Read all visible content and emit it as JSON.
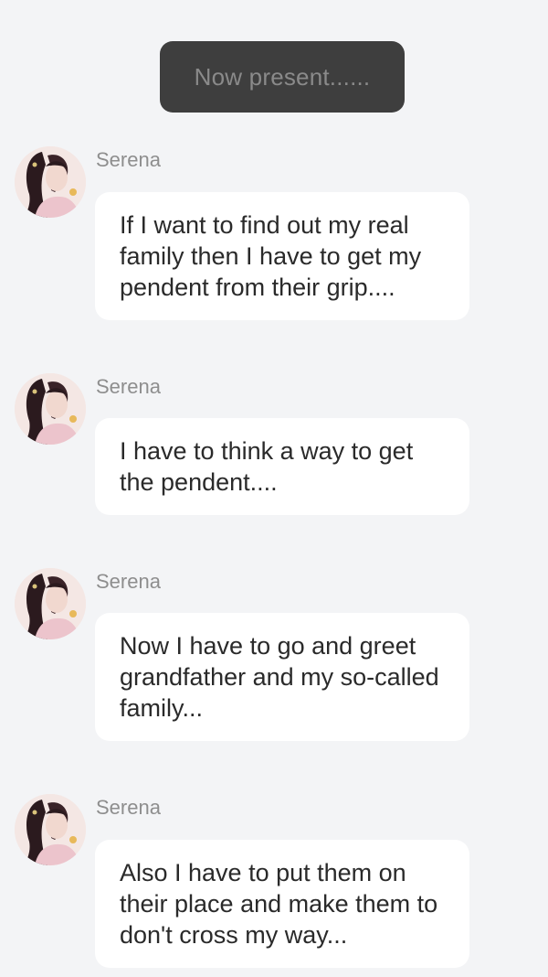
{
  "narration": {
    "text": "Now present......"
  },
  "messages": [
    {
      "sender": "Serena",
      "avatar_icon": "character-portrait-avatar",
      "text": "If I want to find out my real family then I have to get my pendent from their grip...."
    },
    {
      "sender": "Serena",
      "avatar_icon": "character-portrait-avatar",
      "text": "I have to think a way to get the pendent...."
    },
    {
      "sender": "Serena",
      "avatar_icon": "character-portrait-avatar",
      "text": "Now I have to go and greet grandfather and my so-called family..."
    },
    {
      "sender": "Serena",
      "avatar_icon": "character-portrait-avatar",
      "text": "Also I have to put them on their place and make them to don't cross my way..."
    }
  ],
  "colors": {
    "background": "#f3f4f6",
    "narration_bg": "#3e3e3e",
    "narration_text": "#8a8a8a",
    "bubble_bg": "#ffffff",
    "name_text": "#8e8e8e",
    "message_text": "#2a2a2a"
  }
}
